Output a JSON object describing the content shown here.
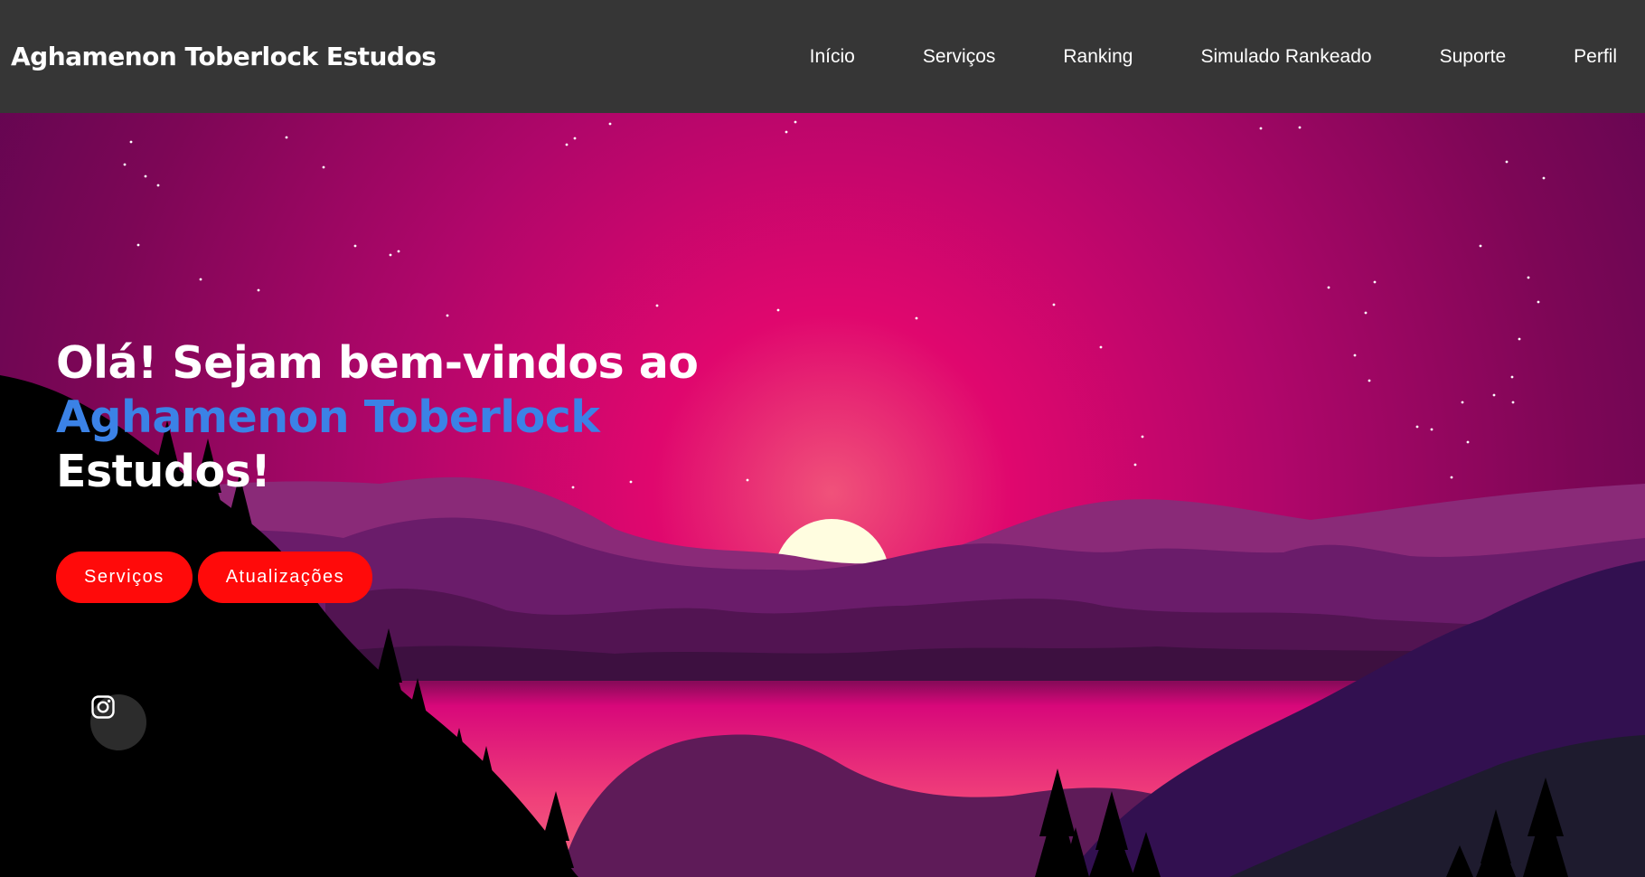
{
  "header": {
    "brand": "Aghamenon Toberlock Estudos",
    "nav": [
      "Início",
      "Serviços",
      "Ranking",
      "Simulado Rankeado",
      "Suporte",
      "Perfil"
    ]
  },
  "hero": {
    "line1": "Olá! Sejam bem-vindos ao",
    "accent": "Aghamenon Toberlock",
    "line3": "Estudos!",
    "buttons": [
      "Serviços",
      "Atualizações"
    ],
    "social_icon": "instagram-icon"
  },
  "colors": {
    "header_bg": "#363636",
    "accent_text": "#3b82e6",
    "button_bg": "#ff0a0a",
    "sky_center": "#e0076e",
    "sun": "#fffde0"
  }
}
